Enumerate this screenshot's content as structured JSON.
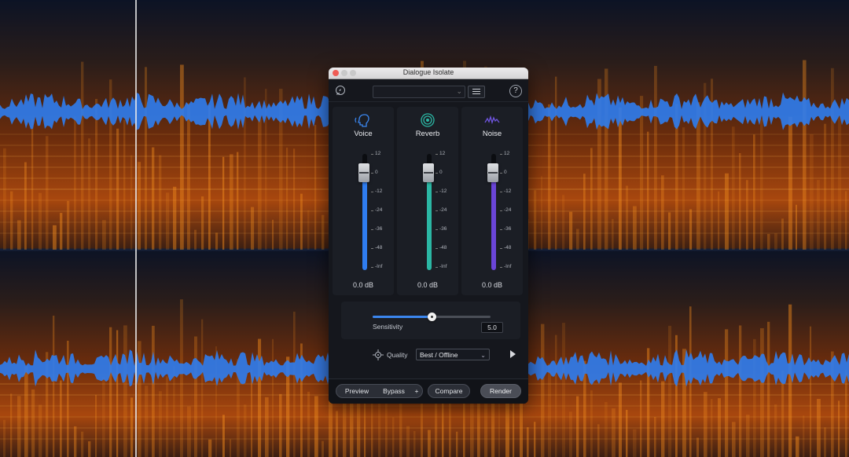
{
  "window": {
    "title": "Dialogue Isolate"
  },
  "toolbar": {
    "preset_value": "",
    "help_label": "?"
  },
  "faders": [
    {
      "id": "voice",
      "label": "Voice",
      "value_text": "0.0 dB",
      "level_db": 0,
      "color": "#2f7df0",
      "icon": "voice-head-icon"
    },
    {
      "id": "reverb",
      "label": "Reverb",
      "value_text": "0.0 dB",
      "level_db": 0,
      "color": "#2bb7a4",
      "icon": "reverb-rings-icon"
    },
    {
      "id": "noise",
      "label": "Noise",
      "value_text": "0.0 dB",
      "level_db": 0,
      "color": "#6a45d8",
      "icon": "noise-wave-icon"
    }
  ],
  "scale": [
    "12",
    "0",
    "-12",
    "-24",
    "-36",
    "-48",
    "-Inf"
  ],
  "sensitivity": {
    "label": "Sensitivity",
    "value": "5.0",
    "fraction": 0.5
  },
  "quality": {
    "label": "Quality",
    "selected": "Best / Offline"
  },
  "buttons": {
    "preview": "Preview",
    "bypass": "Bypass",
    "plus": "+",
    "compare": "Compare",
    "render": "Render"
  },
  "colors": {
    "accent": "#3b86ee",
    "waveform": "#2f7df0",
    "spectrogram_hot": "#f08a1c"
  }
}
